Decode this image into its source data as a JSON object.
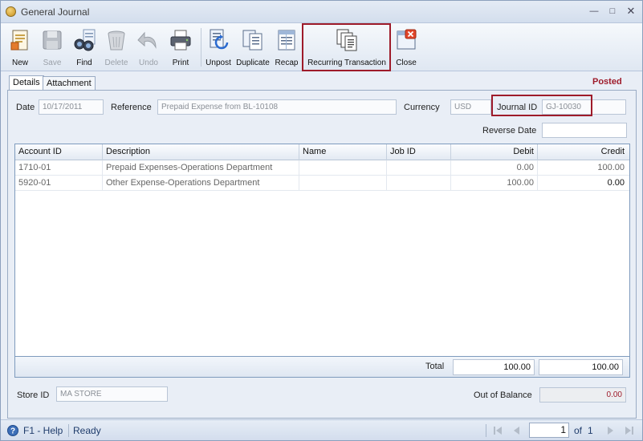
{
  "window": {
    "title": "General Journal"
  },
  "toolbar": {
    "buttons": [
      {
        "label": "New",
        "icon": "new-document-icon",
        "enabled": true
      },
      {
        "label": "Save",
        "icon": "floppy-disk-icon",
        "enabled": false
      },
      {
        "label": "Find",
        "icon": "binoculars-icon",
        "enabled": true
      },
      {
        "label": "Delete",
        "icon": "trash-can-icon",
        "enabled": false
      },
      {
        "label": "Undo",
        "icon": "undo-arrow-icon",
        "enabled": false
      },
      {
        "label": "Print",
        "icon": "printer-icon",
        "enabled": true
      },
      {
        "label": "Unpost",
        "icon": "unpost-icon",
        "enabled": true
      },
      {
        "label": "Duplicate",
        "icon": "duplicate-icon",
        "enabled": true
      },
      {
        "label": "Recap",
        "icon": "recap-icon",
        "enabled": true
      },
      {
        "label": "Recurring Transaction",
        "icon": "recurring-transaction-icon",
        "enabled": true
      },
      {
        "label": "Close",
        "icon": "close-window-icon",
        "enabled": true
      }
    ]
  },
  "tabs": [
    {
      "label": "Details",
      "active": true
    },
    {
      "label": "Attachment",
      "active": false
    }
  ],
  "status": {
    "label": "Posted",
    "color": "#9e1b2a"
  },
  "form": {
    "date_label": "Date",
    "date_value": "10/17/2011",
    "reference_label": "Reference",
    "reference_value": "Prepaid Expense from BL-10108",
    "currency_label": "Currency",
    "currency_value": "USD",
    "journal_id_label": "Journal ID",
    "journal_id_value": "GJ-10030",
    "reverse_date_label": "Reverse Date",
    "reverse_date_value": ""
  },
  "grid": {
    "columns": [
      "Account ID",
      "Description",
      "Name",
      "Job ID",
      "Debit",
      "Credit"
    ],
    "rows": [
      {
        "account_id": "1710-01",
        "description": "Prepaid Expenses-Operations Department",
        "name": "",
        "job_id": "",
        "debit": "0.00",
        "credit": "100.00"
      },
      {
        "account_id": "5920-01",
        "description": "Other Expense-Operations Department",
        "name": "",
        "job_id": "",
        "debit": "100.00",
        "credit": "0.00"
      }
    ]
  },
  "totals": {
    "label": "Total",
    "debit": "100.00",
    "credit": "100.00"
  },
  "footer": {
    "store_id_label": "Store ID",
    "store_id_value": "MA STORE",
    "out_of_balance_label": "Out of Balance",
    "out_of_balance_value": "0.00"
  },
  "statusbar": {
    "help": "F1 - Help",
    "state": "Ready",
    "page": "1",
    "of_label": "of",
    "total_pages": "1"
  },
  "colors": {
    "highlight": "#9e1b2a",
    "accent": "#1f3c6b"
  }
}
